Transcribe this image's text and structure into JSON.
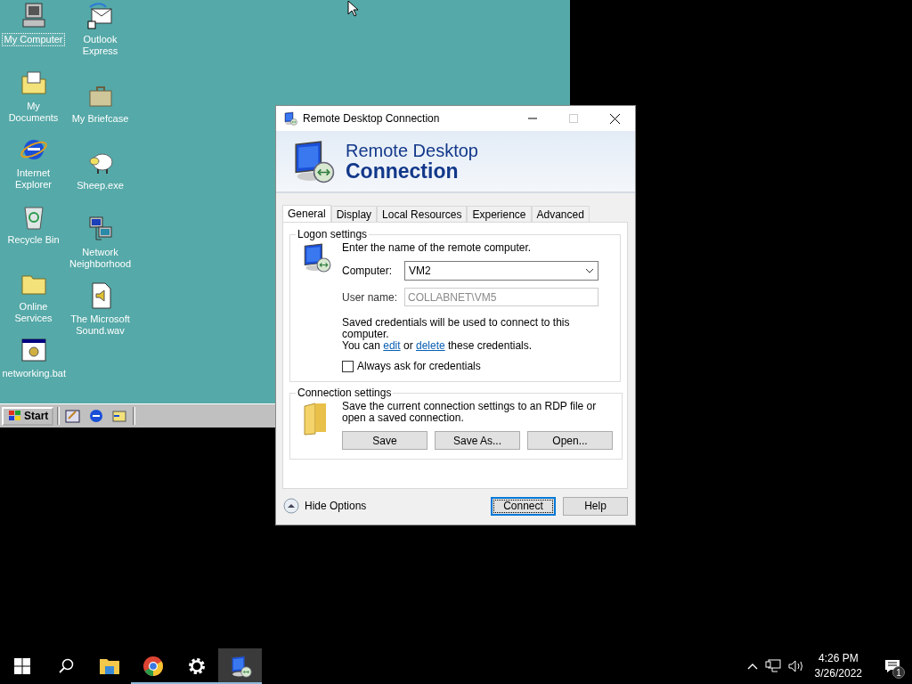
{
  "desktop": {
    "columns": [
      {
        "icons": [
          {
            "kind": "computer",
            "label": "My Computer",
            "selected": true
          },
          {
            "kind": "documents",
            "label": "My Documents",
            "selected": false
          },
          {
            "kind": "ie",
            "label": "Internet Explorer",
            "selected": false
          },
          {
            "kind": "recycle",
            "label": "Recycle Bin",
            "selected": false
          },
          {
            "kind": "folder",
            "label": "Online Services",
            "selected": false
          },
          {
            "kind": "batch",
            "label": "networking.bat",
            "selected": false
          }
        ]
      },
      {
        "icons": [
          {
            "kind": "outlook",
            "label": "Outlook Express",
            "selected": false
          },
          {
            "kind": "briefcase",
            "label": "My Briefcase",
            "selected": false
          },
          {
            "kind": "sheep",
            "label": "Sheep.exe",
            "selected": false
          },
          {
            "kind": "network",
            "label": "Network Neighborhood",
            "selected": false
          },
          {
            "kind": "sound",
            "label": "The Microsoft Sound.wav",
            "selected": false
          }
        ]
      }
    ],
    "taskbar": {
      "start": "Start",
      "quick_launch": [
        {
          "kind": "desktop"
        },
        {
          "kind": "ie"
        },
        {
          "kind": "channels"
        }
      ]
    }
  },
  "dialog": {
    "title": "Remote Desktop Connection",
    "maximize_enabled": false,
    "banner": {
      "line1": "Remote Desktop",
      "line2": "Connection"
    },
    "tabs": [
      {
        "label": "General",
        "selected": true
      },
      {
        "label": "Display",
        "selected": false
      },
      {
        "label": "Local Resources",
        "selected": false
      },
      {
        "label": "Experience",
        "selected": false
      },
      {
        "label": "Advanced",
        "selected": false
      }
    ],
    "logon": {
      "heading": "Logon settings",
      "prompt": "Enter the name of the remote computer.",
      "computer_label": "Computer:",
      "computer_value": "VM2",
      "username_label": "User name:",
      "username_value": "COLLABNET\\VM5",
      "note_line1": "Saved credentials will be used to connect to this computer.",
      "note_before": "You can ",
      "edit_link": "edit",
      "note_middle": " or ",
      "delete_link": "delete",
      "note_after": " these credentials.",
      "checkbox": {
        "label": "Always ask for credentials",
        "checked": false
      }
    },
    "connection": {
      "heading": "Connection settings",
      "text": "Save the current connection settings to an RDP file or open a saved connection.",
      "buttons": [
        "Save",
        "Save As...",
        "Open..."
      ]
    },
    "footer": {
      "toggle": "Hide Options",
      "buttons": [
        {
          "label": "Connect",
          "default": true
        },
        {
          "label": "Help",
          "default": false
        }
      ]
    }
  },
  "taskbar": {
    "items": [
      {
        "kind": "start",
        "running": false,
        "selected": false
      },
      {
        "kind": "search",
        "running": false,
        "selected": false
      },
      {
        "kind": "explorer",
        "running": false,
        "selected": false
      },
      {
        "kind": "chrome",
        "running": true,
        "selected": false
      },
      {
        "kind": "settings",
        "running": true,
        "selected": false
      },
      {
        "kind": "rdp",
        "running": true,
        "selected": true
      }
    ],
    "tray": {
      "time": "4:26 PM",
      "date": "3/26/2022",
      "notifications": "1"
    }
  }
}
